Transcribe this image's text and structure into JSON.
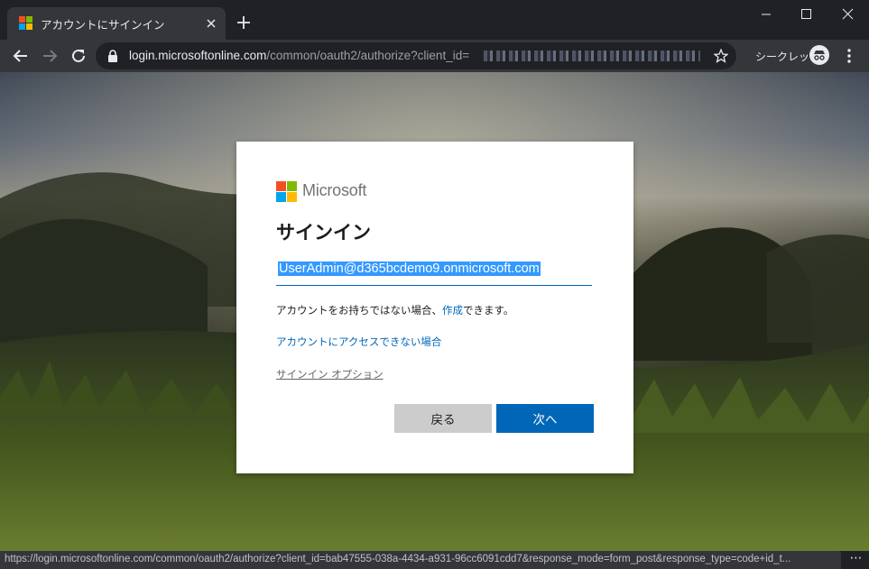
{
  "browser": {
    "tab": {
      "title": "アカウントにサインイン"
    },
    "address_bar": {
      "host": "login.microsoftonline.com",
      "path": "/common/oauth2/authorize?client_id="
    },
    "incognito_label": "シークレット",
    "status_url": "https://login.microsoftonline.com/common/oauth2/authorize?client_id=bab47555-038a-4434-a931-96cc6091cdd7&response_mode=form_post&response_type=code+id_t...",
    "status_more": "⋯"
  },
  "signin": {
    "brand": "Microsoft",
    "title": "サインイン",
    "email_value": "UserAdmin@d365bcdemo9.onmicrosoft.com",
    "no_account_text": "アカウントをお持ちではない場合、",
    "create_link": "作成",
    "no_account_suffix": "できます。",
    "cant_access_link": "アカウントにアクセスできない場合",
    "signin_options_link": "サインイン オプション",
    "back_button": "戻る",
    "next_button": "次へ"
  },
  "colors": {
    "accent": "#0067b8",
    "logo_red": "#f25022",
    "logo_green": "#7fba00",
    "logo_blue": "#00a4ef",
    "logo_yellow": "#ffb900"
  }
}
